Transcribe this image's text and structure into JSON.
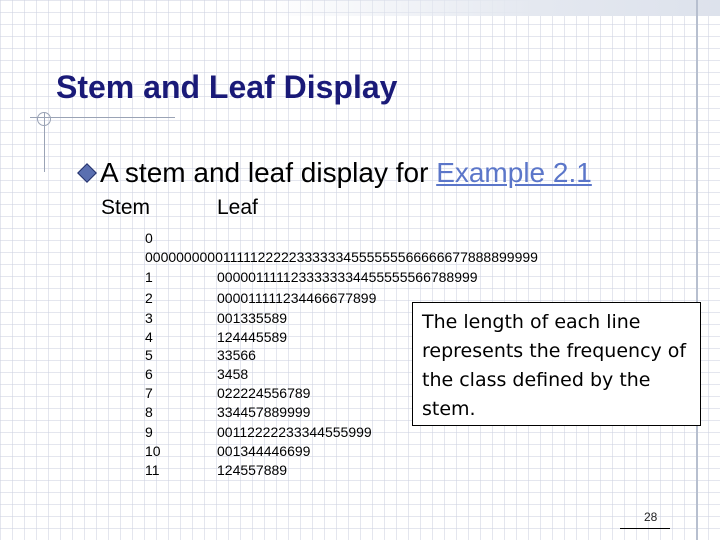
{
  "slide": {
    "title": "Stem and Leaf Display",
    "bullet_prefix": "A stem and leaf display for ",
    "bullet_link": "Example 2.1",
    "headers": {
      "stem": "Stem",
      "leaf": "Leaf"
    },
    "first_row_stem": "0",
    "first_row_leaves": "000000000011111222223333334555555566666677888899999",
    "rows": [
      {
        "stem": "1",
        "leaves": "0000011111233333334455555566788999"
      },
      {
        "stem": "2",
        "leaves": "000011111234466677899"
      },
      {
        "stem": "3",
        "leaves": "001335589"
      },
      {
        "stem": "4",
        "leaves": "124445589"
      },
      {
        "stem": "5",
        "leaves": "33566"
      },
      {
        "stem": "6",
        "leaves": "3458"
      },
      {
        "stem": "7",
        "leaves": "022224556789"
      },
      {
        "stem": "8",
        "leaves": "334457889999"
      },
      {
        "stem": "9",
        "leaves": "00112222233344555999"
      },
      {
        "stem": "10",
        "leaves": "001344446699"
      },
      {
        "stem": "11",
        "leaves": "124557889"
      }
    ],
    "callout": "The length of each line represents the frequency of the class defined by the stem.",
    "page_number": "28"
  }
}
